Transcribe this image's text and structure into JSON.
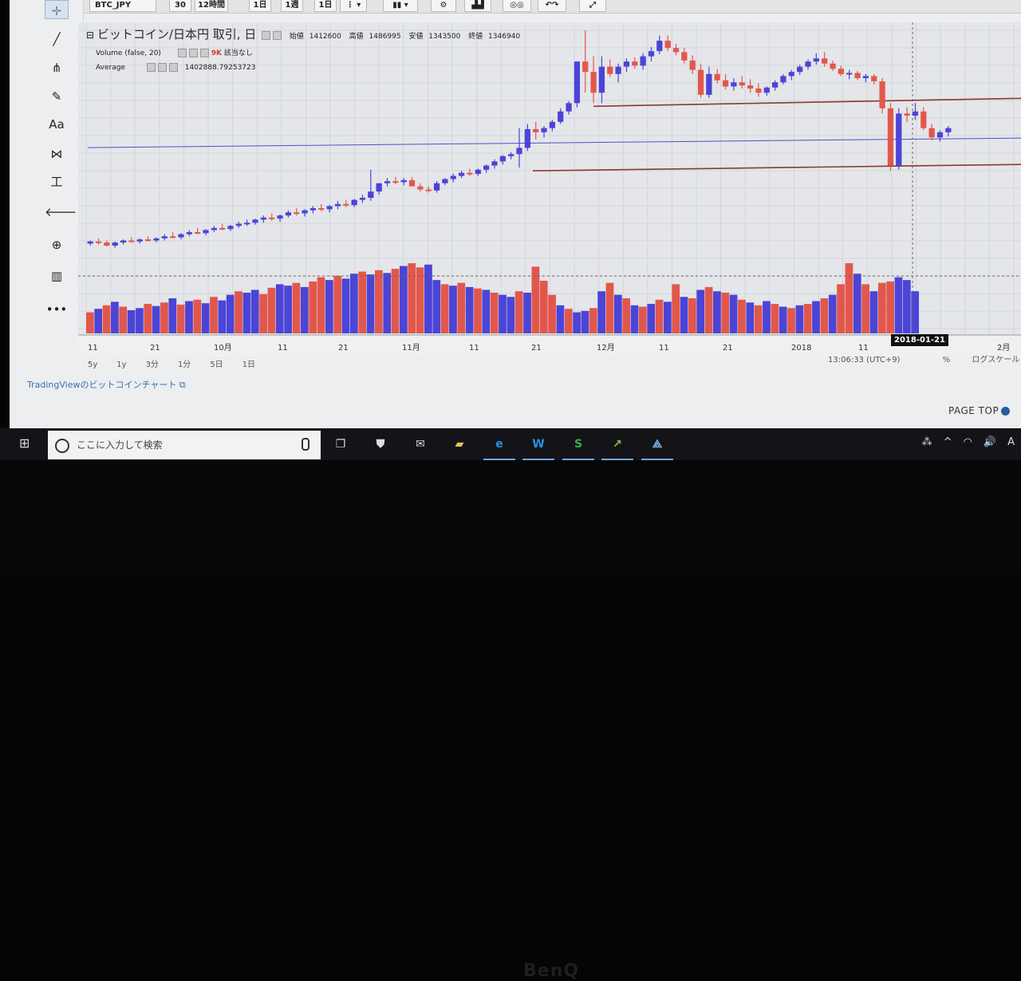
{
  "toolbar": {
    "symbol": "BTC_JPY",
    "buttons": [
      "30",
      "12時間",
      "1日",
      "1週",
      "1日"
    ]
  },
  "left_tools": [
    {
      "icon": "crosshair-icon",
      "glyph": "✛"
    },
    {
      "icon": "trend-line-icon",
      "glyph": "╱"
    },
    {
      "icon": "pitchfork-icon",
      "glyph": "⋔"
    },
    {
      "icon": "brush-icon",
      "glyph": "✎"
    },
    {
      "icon": "text-tool-icon",
      "glyph": "Aa"
    },
    {
      "icon": "pattern-icon",
      "glyph": "⋈"
    },
    {
      "icon": "measure-icon",
      "glyph": "工"
    },
    {
      "icon": "back-arrow-icon",
      "glyph": "🡐"
    },
    {
      "icon": "zoom-icon",
      "glyph": "⊕"
    },
    {
      "icon": "bars-icon",
      "glyph": "▥"
    },
    {
      "icon": "more-icon",
      "glyph": "•••"
    }
  ],
  "header": {
    "title": "ビットコイン/日本円 取引, 日",
    "open_label": "始値",
    "open": "1412600",
    "high_label": "高値",
    "high": "1486995",
    "low_label": "安値",
    "low": "1343500",
    "close_label": "終値",
    "close": "1346940",
    "volume_label": "Volume (false, 20)",
    "volume_value": "9K",
    "volume_na": "該当なし",
    "average_label": "Average",
    "average_value": "1402888.79253723"
  },
  "x_axis_labels": [
    "11",
    "21",
    "10月",
    "11",
    "21",
    "11月",
    "11",
    "21",
    "12月",
    "11",
    "21",
    "2018",
    "11",
    "2月"
  ],
  "crosshair_date": "2018-01-21",
  "timeframes": [
    "5y",
    "1y",
    "3分",
    "1分",
    "5日",
    "1日"
  ],
  "statusline": {
    "time": "13:06:33 (UTC+9)",
    "percent": "%",
    "log": "ログスケール"
  },
  "tv_link": "TradingViewのビットコインチャート",
  "page_top": "PAGE TOP",
  "taskbar": {
    "search_placeholder": "ここに入力して検索",
    "apps": [
      {
        "icon": "task-view-icon",
        "glyph": "❐",
        "color": "#dddddd"
      },
      {
        "icon": "store-icon",
        "glyph": "⛊",
        "color": "#dddddd"
      },
      {
        "icon": "mail-icon",
        "glyph": "✉",
        "color": "#dddddd"
      },
      {
        "icon": "folder-icon",
        "glyph": "▰",
        "color": "#e8c24a"
      },
      {
        "icon": "edge-icon",
        "glyph": "e",
        "color": "#2b8fe0"
      },
      {
        "icon": "writer-icon",
        "glyph": "W",
        "color": "#2b8fe0"
      },
      {
        "icon": "spreadsheet-icon",
        "glyph": "S",
        "color": "#2fb24a"
      },
      {
        "icon": "chart-app-icon",
        "glyph": "↗",
        "color": "#8bc34a"
      },
      {
        "icon": "network-app-icon",
        "glyph": "⟁",
        "color": "#7fb2e5"
      }
    ],
    "tray": [
      "⁂",
      "^",
      "◠",
      "🔊",
      "A"
    ]
  },
  "bezel_brand": "BenQ",
  "chart_data": {
    "type": "candlestick",
    "colors": {
      "up": "#4b44d6",
      "down": "#e2574c",
      "support": "#8b3a2a",
      "average": "#4a52c8"
    },
    "ylim": [
      200000,
      2500000
    ],
    "average": 1402888.79,
    "support_levels": [
      1800000,
      1180000
    ],
    "candles": [
      [
        450000,
        480000,
        430000,
        470000
      ],
      [
        470000,
        500000,
        440000,
        460000
      ],
      [
        460000,
        480000,
        420000,
        430000
      ],
      [
        430000,
        470000,
        410000,
        460000
      ],
      [
        460000,
        490000,
        440000,
        480000
      ],
      [
        480000,
        510000,
        460000,
        470000
      ],
      [
        470000,
        500000,
        450000,
        490000
      ],
      [
        490000,
        520000,
        470000,
        480000
      ],
      [
        480000,
        510000,
        460000,
        500000
      ],
      [
        500000,
        540000,
        480000,
        520000
      ],
      [
        520000,
        560000,
        500000,
        510000
      ],
      [
        510000,
        550000,
        490000,
        540000
      ],
      [
        540000,
        580000,
        520000,
        560000
      ],
      [
        560000,
        600000,
        540000,
        550000
      ],
      [
        550000,
        590000,
        530000,
        580000
      ],
      [
        580000,
        620000,
        560000,
        600000
      ],
      [
        600000,
        640000,
        580000,
        590000
      ],
      [
        590000,
        630000,
        570000,
        620000
      ],
      [
        620000,
        660000,
        600000,
        640000
      ],
      [
        640000,
        680000,
        620000,
        650000
      ],
      [
        650000,
        690000,
        630000,
        680000
      ],
      [
        680000,
        720000,
        650000,
        700000
      ],
      [
        700000,
        740000,
        670000,
        690000
      ],
      [
        690000,
        730000,
        660000,
        720000
      ],
      [
        720000,
        770000,
        700000,
        750000
      ],
      [
        750000,
        790000,
        720000,
        740000
      ],
      [
        740000,
        780000,
        710000,
        770000
      ],
      [
        770000,
        810000,
        740000,
        790000
      ],
      [
        790000,
        830000,
        760000,
        780000
      ],
      [
        780000,
        820000,
        750000,
        810000
      ],
      [
        810000,
        860000,
        780000,
        830000
      ],
      [
        830000,
        870000,
        800000,
        820000
      ],
      [
        820000,
        880000,
        800000,
        870000
      ],
      [
        870000,
        920000,
        840000,
        890000
      ],
      [
        890000,
        1160000,
        860000,
        950000
      ],
      [
        950000,
        1000000,
        920000,
        1030000
      ],
      [
        1030000,
        1080000,
        1000000,
        1050000
      ],
      [
        1050000,
        1090000,
        1020000,
        1040000
      ],
      [
        1040000,
        1080000,
        1010000,
        1060000
      ],
      [
        1060000,
        1090000,
        1020000,
        1000000
      ],
      [
        1000000,
        1030000,
        950000,
        970000
      ],
      [
        970000,
        1000000,
        940000,
        960000
      ],
      [
        960000,
        1050000,
        940000,
        1030000
      ],
      [
        1030000,
        1080000,
        1010000,
        1070000
      ],
      [
        1070000,
        1120000,
        1040000,
        1100000
      ],
      [
        1100000,
        1150000,
        1080000,
        1130000
      ],
      [
        1130000,
        1170000,
        1100000,
        1120000
      ],
      [
        1120000,
        1170000,
        1100000,
        1160000
      ],
      [
        1160000,
        1210000,
        1130000,
        1200000
      ],
      [
        1200000,
        1260000,
        1170000,
        1240000
      ],
      [
        1240000,
        1300000,
        1210000,
        1290000
      ],
      [
        1290000,
        1330000,
        1260000,
        1310000
      ],
      [
        1310000,
        1560000,
        1180000,
        1370000
      ],
      [
        1370000,
        1600000,
        1340000,
        1550000
      ],
      [
        1550000,
        1620000,
        1450000,
        1520000
      ],
      [
        1520000,
        1580000,
        1470000,
        1560000
      ],
      [
        1560000,
        1640000,
        1530000,
        1620000
      ],
      [
        1620000,
        1750000,
        1600000,
        1720000
      ],
      [
        1720000,
        1820000,
        1690000,
        1800000
      ],
      [
        1800000,
        1900000,
        1760000,
        2200000
      ],
      [
        2200000,
        2500000,
        1900000,
        2100000
      ],
      [
        2100000,
        2250000,
        1800000,
        1900000
      ],
      [
        1900000,
        2250000,
        1800000,
        2150000
      ],
      [
        2150000,
        2220000,
        2050000,
        2080000
      ],
      [
        2080000,
        2180000,
        2000000,
        2150000
      ],
      [
        2150000,
        2230000,
        2100000,
        2200000
      ],
      [
        2200000,
        2240000,
        2130000,
        2160000
      ],
      [
        2160000,
        2280000,
        2120000,
        2250000
      ],
      [
        2250000,
        2340000,
        2200000,
        2300000
      ],
      [
        2300000,
        2450000,
        2270000,
        2400000
      ],
      [
        2400000,
        2450000,
        2300000,
        2330000
      ],
      [
        2330000,
        2370000,
        2260000,
        2290000
      ],
      [
        2290000,
        2330000,
        2180000,
        2210000
      ],
      [
        2210000,
        2260000,
        2080000,
        2120000
      ],
      [
        2120000,
        2180000,
        1850000,
        1880000
      ],
      [
        1880000,
        2150000,
        1850000,
        2080000
      ],
      [
        2080000,
        2130000,
        1990000,
        2020000
      ],
      [
        2020000,
        2080000,
        1930000,
        1960000
      ],
      [
        1960000,
        2040000,
        1920000,
        2000000
      ],
      [
        2000000,
        2060000,
        1940000,
        1970000
      ],
      [
        1970000,
        2030000,
        1900000,
        1940000
      ],
      [
        1940000,
        1990000,
        1860000,
        1900000
      ],
      [
        1900000,
        1960000,
        1870000,
        1950000
      ],
      [
        1950000,
        2020000,
        1920000,
        2000000
      ],
      [
        2000000,
        2080000,
        1980000,
        2060000
      ],
      [
        2060000,
        2120000,
        2020000,
        2100000
      ],
      [
        2100000,
        2170000,
        2070000,
        2150000
      ],
      [
        2150000,
        2220000,
        2120000,
        2200000
      ],
      [
        2200000,
        2280000,
        2170000,
        2230000
      ],
      [
        2230000,
        2290000,
        2150000,
        2180000
      ],
      [
        2180000,
        2210000,
        2110000,
        2130000
      ],
      [
        2130000,
        2160000,
        2060000,
        2080000
      ],
      [
        2080000,
        2120000,
        2030000,
        2090000
      ],
      [
        2090000,
        2110000,
        2020000,
        2040000
      ],
      [
        2040000,
        2080000,
        2000000,
        2060000
      ],
      [
        2060000,
        2080000,
        1980000,
        2010000
      ],
      [
        2010000,
        2040000,
        1700000,
        1750000
      ],
      [
        1750000,
        1800000,
        1150000,
        1200000
      ],
      [
        1200000,
        1750000,
        1160000,
        1700000
      ],
      [
        1700000,
        1760000,
        1620000,
        1680000
      ],
      [
        1680000,
        1800000,
        1640000,
        1720000
      ],
      [
        1720000,
        1760000,
        1540000,
        1560000
      ],
      [
        1560000,
        1600000,
        1440000,
        1470000
      ],
      [
        1470000,
        1540000,
        1430000,
        1520000
      ],
      [
        1520000,
        1580000,
        1480000,
        1560000
      ]
    ],
    "volume": [
      [
        30,
        0
      ],
      [
        35,
        1
      ],
      [
        40,
        0
      ],
      [
        45,
        1
      ],
      [
        38,
        0
      ],
      [
        33,
        1
      ],
      [
        36,
        1
      ],
      [
        42,
        0
      ],
      [
        39,
        1
      ],
      [
        44,
        0
      ],
      [
        50,
        1
      ],
      [
        41,
        0
      ],
      [
        46,
        1
      ],
      [
        48,
        0
      ],
      [
        43,
        1
      ],
      [
        52,
        0
      ],
      [
        47,
        1
      ],
      [
        55,
        1
      ],
      [
        60,
        0
      ],
      [
        58,
        1
      ],
      [
        62,
        1
      ],
      [
        56,
        0
      ],
      [
        65,
        0
      ],
      [
        70,
        1
      ],
      [
        68,
        1
      ],
      [
        72,
        0
      ],
      [
        66,
        1
      ],
      [
        74,
        0
      ],
      [
        80,
        0
      ],
      [
        76,
        1
      ],
      [
        82,
        0
      ],
      [
        78,
        1
      ],
      [
        85,
        1
      ],
      [
        88,
        0
      ],
      [
        84,
        1
      ],
      [
        90,
        0
      ],
      [
        86,
        1
      ],
      [
        92,
        0
      ],
      [
        96,
        1
      ],
      [
        100,
        0
      ],
      [
        94,
        0
      ],
      [
        98,
        1
      ],
      [
        76,
        1
      ],
      [
        70,
        0
      ],
      [
        68,
        1
      ],
      [
        72,
        0
      ],
      [
        66,
        1
      ],
      [
        64,
        0
      ],
      [
        62,
        1
      ],
      [
        58,
        0
      ],
      [
        55,
        1
      ],
      [
        52,
        1
      ],
      [
        60,
        0
      ],
      [
        58,
        1
      ],
      [
        95,
        0
      ],
      [
        75,
        0
      ],
      [
        55,
        0
      ],
      [
        40,
        1
      ],
      [
        35,
        0
      ],
      [
        30,
        1
      ],
      [
        32,
        1
      ],
      [
        36,
        0
      ],
      [
        60,
        1
      ],
      [
        72,
        0
      ],
      [
        55,
        1
      ],
      [
        50,
        0
      ],
      [
        40,
        1
      ],
      [
        38,
        0
      ],
      [
        42,
        1
      ],
      [
        48,
        0
      ],
      [
        45,
        1
      ],
      [
        70,
        0
      ],
      [
        52,
        1
      ],
      [
        50,
        0
      ],
      [
        62,
        1
      ],
      [
        66,
        0
      ],
      [
        60,
        1
      ],
      [
        58,
        0
      ],
      [
        55,
        1
      ],
      [
        48,
        0
      ],
      [
        44,
        1
      ],
      [
        40,
        0
      ],
      [
        46,
        1
      ],
      [
        42,
        0
      ],
      [
        38,
        1
      ],
      [
        36,
        0
      ],
      [
        40,
        1
      ],
      [
        42,
        0
      ],
      [
        46,
        1
      ],
      [
        50,
        0
      ],
      [
        55,
        1
      ],
      [
        70,
        0
      ],
      [
        100,
        0
      ],
      [
        85,
        1
      ],
      [
        70,
        0
      ],
      [
        60,
        1
      ],
      [
        72,
        0
      ],
      [
        74,
        0
      ],
      [
        80,
        1
      ],
      [
        76,
        1
      ],
      [
        60,
        1
      ]
    ]
  }
}
